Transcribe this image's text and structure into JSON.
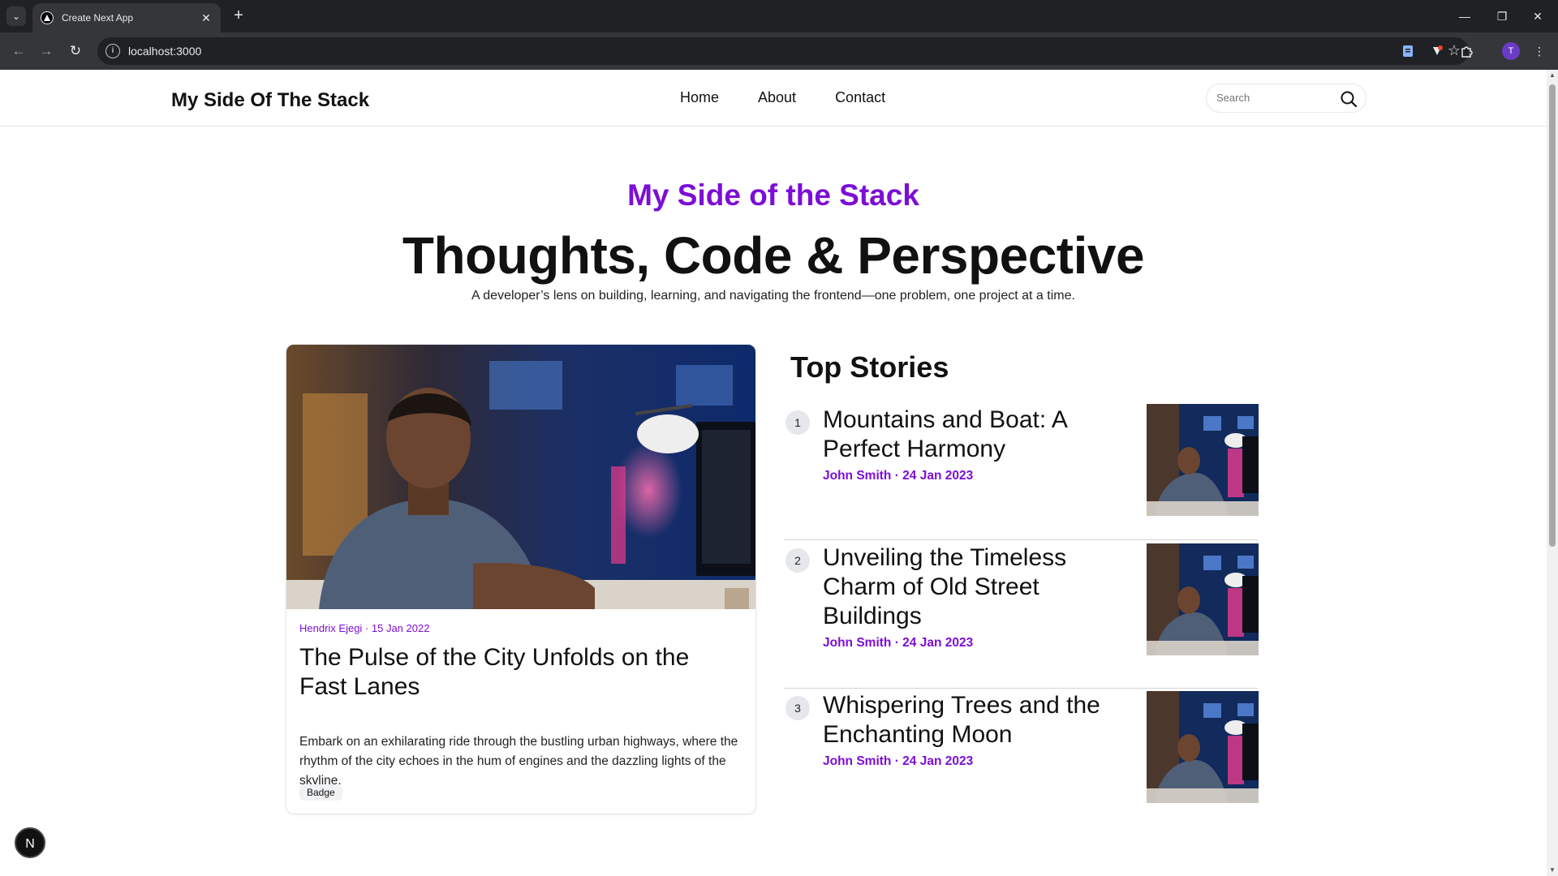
{
  "browser": {
    "tab_title": "Create Next App",
    "url": "localhost:3000",
    "profile_initial": "T"
  },
  "header": {
    "logo": "My Side Of The Stack",
    "nav": [
      "Home",
      "About",
      "Contact"
    ],
    "search_placeholder": "Search"
  },
  "hero": {
    "subtitle": "My Side of the Stack",
    "title": "Thoughts, Code & Perspective",
    "description": "A developer’s lens on building, learning, and navigating the frontend—one problem, one project at a time."
  },
  "featured": {
    "meta": "Hendrix Ejegi · 15 Jan 2022",
    "title": "The Pulse of the City Unfolds on the Fast Lanes",
    "excerpt": "Embark on an exhilarating ride through the bustling urban highways, where the rhythm of the city echoes in the hum of engines and the dazzling lights of the skyline.",
    "badge": "Badge"
  },
  "top_stories": {
    "heading": "Top Stories",
    "items": [
      {
        "num": "1",
        "title": "Mountains and Boat: A Perfect Harmony",
        "meta": "John Smith · 24 Jan 2023"
      },
      {
        "num": "2",
        "title": "Unveiling the Timeless Charm of Old Street Buildings",
        "meta": "John Smith · 24 Jan 2023"
      },
      {
        "num": "3",
        "title": "Whispering Trees and the Enchanting Moon",
        "meta": "John Smith · 24 Jan 2023"
      }
    ]
  },
  "next_badge": "N",
  "colors": {
    "accent": "#7c0ed6",
    "text": "#111111",
    "border": "#e5e7eb"
  }
}
